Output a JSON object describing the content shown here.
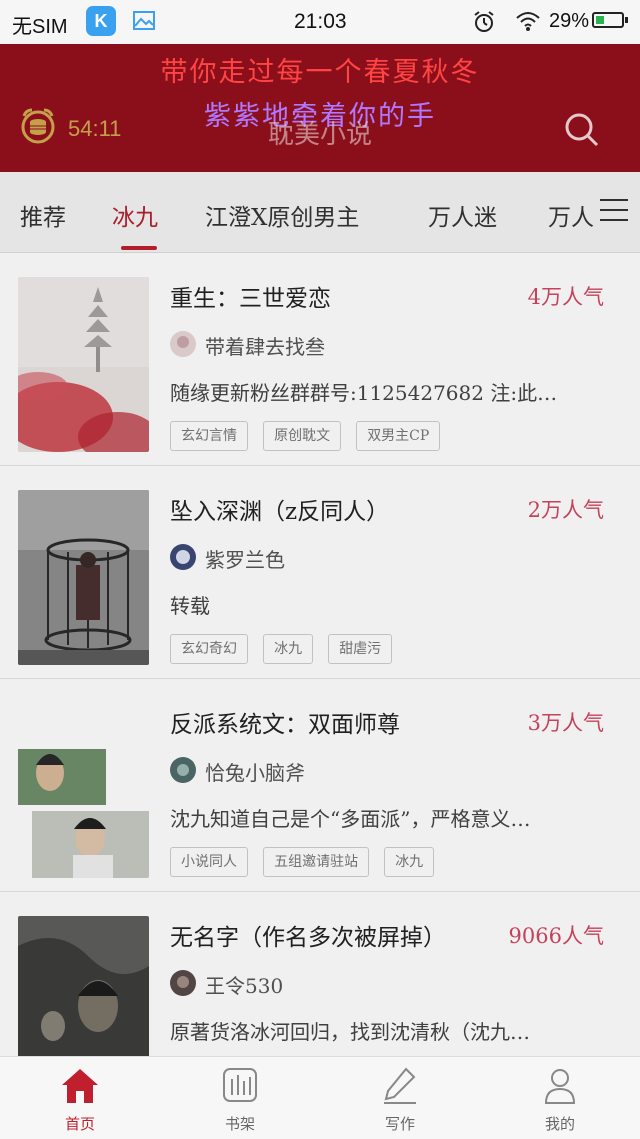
{
  "status_bar": {
    "carrier": "无SIM",
    "app_icon_letter": "K",
    "time": "21:03",
    "battery": "29%",
    "icons": [
      "k-app-icon",
      "image-icon",
      "alarm-icon",
      "wifi-icon",
      "battery-icon"
    ]
  },
  "header": {
    "banner_line1": "带你走过每一个春夏秋冬",
    "banner_line2": "紫紫地牵着你的手",
    "timer": "54:11",
    "title": "耽美小说",
    "background_color": "#8b0f1a"
  },
  "tabs": [
    {
      "label": "推荐"
    },
    {
      "label": "冰九"
    },
    {
      "label": "江澄X原创男主"
    },
    {
      "label": "万人迷"
    },
    {
      "label": "万人"
    }
  ],
  "active_tab": "冰九",
  "books": [
    {
      "title": "重生：三世爱恋",
      "popularity": "4万人气",
      "author": "带着肆去找叁",
      "desc": "随缘更新粉丝群群号:1125427682 注:此…",
      "tags": [
        "玄幻言情",
        "原创耽文",
        "双男主CP"
      ]
    },
    {
      "title": "坠入深渊（z反同人）",
      "popularity": "2万人气",
      "author": "紫罗兰色",
      "desc": "转载",
      "tags": [
        "玄幻奇幻",
        "冰九",
        "甜虐污"
      ]
    },
    {
      "title": "反派系统文：双面师尊",
      "popularity": "3万人气",
      "author": "恰兔小脑斧",
      "desc": "沈九知道自己是个“多面派”，严格意义…",
      "tags": [
        "小说同人",
        "五组邀请驻站",
        "冰九"
      ]
    },
    {
      "title": "无名字（作名多次被屏掉）",
      "popularity": "9066人气",
      "author": "王令530",
      "desc": "原著货洛冰河回归，找到沈清秋（沈九…",
      "tags": []
    }
  ],
  "bottom_nav": [
    {
      "label": "首页",
      "icon": "home-icon",
      "active": true
    },
    {
      "label": "书架",
      "icon": "bookshelf-icon",
      "active": false
    },
    {
      "label": "写作",
      "icon": "pen-icon",
      "active": false
    },
    {
      "label": "我的",
      "icon": "user-icon",
      "active": false
    }
  ],
  "colors": {
    "accent": "#c0202e",
    "popularity": "#d24760",
    "timer": "#c4a04a"
  }
}
